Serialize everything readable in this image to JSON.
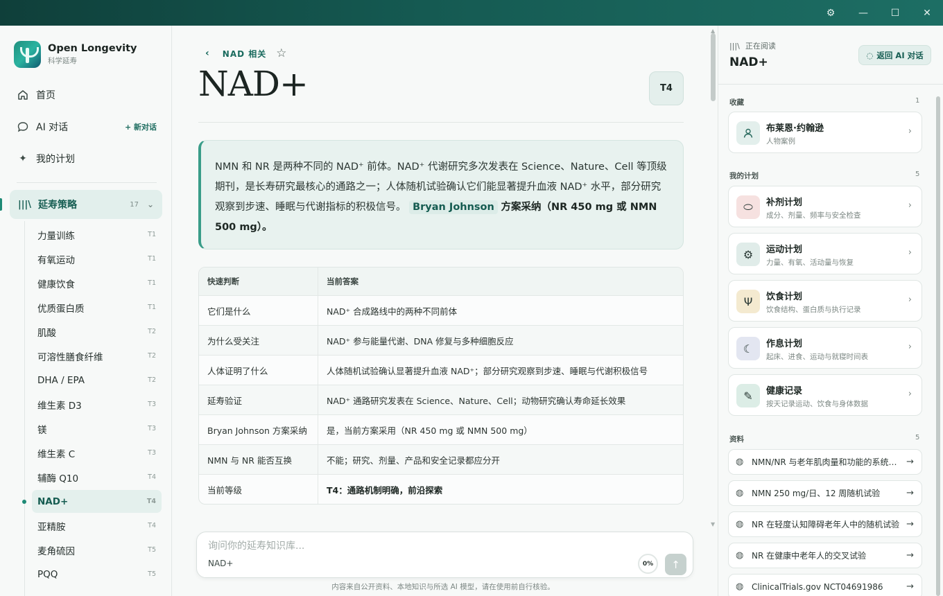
{
  "window": {
    "settings_icon": "gear-icon",
    "minimize": "—",
    "maximize": "☐",
    "close": "✕"
  },
  "brand": {
    "name": "Open Longevity",
    "subtitle": "科学延寿"
  },
  "nav": {
    "home": "首页",
    "ai_chat": "AI 对话",
    "new_chat": "+ 新对话",
    "my_plan": "我的计划"
  },
  "section": {
    "label": "延寿策略",
    "count": "17"
  },
  "strategies": [
    {
      "name": "力量训练",
      "tier": "T1"
    },
    {
      "name": "有氧运动",
      "tier": "T1"
    },
    {
      "name": "健康饮食",
      "tier": "T1"
    },
    {
      "name": "优质蛋白质",
      "tier": "T1"
    },
    {
      "name": "肌酸",
      "tier": "T2"
    },
    {
      "name": "可溶性膳食纤维",
      "tier": "T2"
    },
    {
      "name": "DHA / EPA",
      "tier": "T2"
    },
    {
      "name": "维生素 D3",
      "tier": "T3"
    },
    {
      "name": "镁",
      "tier": "T3"
    },
    {
      "name": "维生素 C",
      "tier": "T3"
    },
    {
      "name": "辅酶 Q10",
      "tier": "T4"
    },
    {
      "name": "NAD+",
      "tier": "T4"
    },
    {
      "name": "亚精胺",
      "tier": "T4"
    },
    {
      "name": "麦角硫因",
      "tier": "T5"
    },
    {
      "name": "PQQ",
      "tier": "T5"
    }
  ],
  "article": {
    "breadcrumb": "NAD 相关",
    "title": "NAD+",
    "tier_badge": "T4",
    "callout_text": "NMN 和 NR 是两种不同的 NAD⁺ 前体。NAD⁺ 代谢研究多次发表在 Science、Nature、Cell 等顶级期刊，是长寿研究最核心的通路之一；人体随机试验确认它们能显著提升血液 NAD⁺ 水平，部分研究观察到步速、睡眠与代谢指标的积极信号。",
    "callout_person": "Bryan Johnson",
    "callout_plan": "方案采纳（NR 450 mg 或 NMN 500 mg）。"
  },
  "quick_table": {
    "headers": [
      "快速判断",
      "当前答案"
    ],
    "rows": [
      [
        "它们是什么",
        "NAD⁺ 合成路线中的两种不同前体"
      ],
      [
        "为什么受关注",
        "NAD⁺ 参与能量代谢、DNA 修复与多种细胞反应"
      ],
      [
        "人体证明了什么",
        "人体随机试验确认显著提升血液 NAD⁺；部分研究观察到步速、睡眠与代谢积极信号"
      ],
      [
        "延寿验证",
        "NAD⁺ 通路研究发表在 Science、Nature、Cell；动物研究确认寿命延长效果"
      ],
      [
        "Bryan Johnson 方案采纳",
        "是，当前方案采用（NR 450 mg 或 NMN 500 mg）"
      ],
      [
        "NMN 与 NR 能否互换",
        "不能；研究、剂量、产品和安全记录都应分开"
      ],
      [
        "当前等级",
        "T4：通路机制明确，前沿探索"
      ]
    ]
  },
  "ask": {
    "placeholder": "询问你的延寿知识库...",
    "context": "NAD+",
    "progress": "0%",
    "send_icon": "arrow-up-icon"
  },
  "footnote": "内容来自公开资料、本地知识与所选 AI 模型，请在使用前自行核验。",
  "right": {
    "reading_label": "正在阅读",
    "reading_title": "NAD+",
    "back_button": "返回 AI 对话",
    "favorites": {
      "label": "收藏",
      "count": "1",
      "items": [
        {
          "title": "布莱恩·约翰逊",
          "sub": "人物案例",
          "icon": "person-icon"
        }
      ]
    },
    "plans": {
      "label": "我的计划",
      "count": "5",
      "items": [
        {
          "title": "补剂计划",
          "sub": "成分、剂量、频率与安全检查",
          "icon": "pill-icon",
          "color": "#f6e1e0"
        },
        {
          "title": "运动计划",
          "sub": "力量、有氧、活动量与恢复",
          "icon": "dumbbell-icon",
          "color": "#e0ece9"
        },
        {
          "title": "饮食计划",
          "sub": "饮食结构、蛋白质与执行记录",
          "icon": "utensils-icon",
          "color": "#f4ead0"
        },
        {
          "title": "作息计划",
          "sub": "起床、进食、运动与就寝时间表",
          "icon": "moon-icon",
          "color": "#e3e6f1"
        },
        {
          "title": "健康记录",
          "sub": "按天记录运动、饮食与身体数据",
          "icon": "notebook-icon",
          "color": "#dcede6"
        }
      ]
    },
    "resources": {
      "label": "资料",
      "count": "5",
      "items": [
        "NMN/NR 与老年肌肉量和功能的系统综述",
        "NMN 250 mg/日、12 周随机试验",
        "NR 在轻度认知障碍老年人中的随机试验",
        "NR 在健康中老年人的交叉试验",
        "ClinicalTrials.gov NCT04691986"
      ]
    }
  }
}
